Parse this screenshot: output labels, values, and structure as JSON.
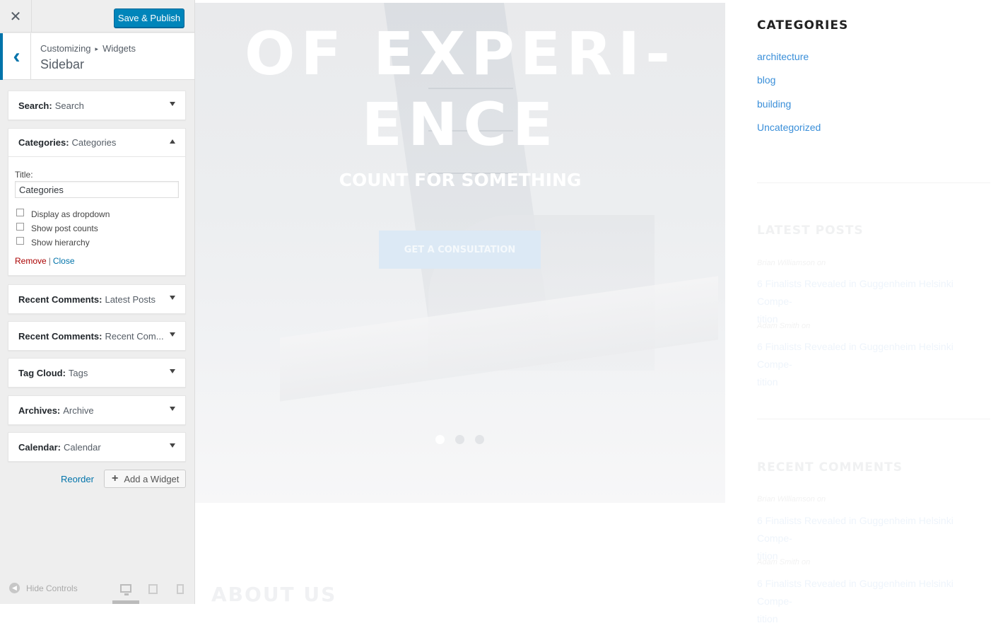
{
  "customizer": {
    "save_label": "Save & Publish",
    "close_glyph": "✕",
    "back_glyph": "‹",
    "breadcrumb": {
      "part1": "Customizing",
      "separator": "▸",
      "part2": "Widgets"
    },
    "panel_title": "Sidebar",
    "widgets": [
      {
        "type": "Search:",
        "name": "Search",
        "expanded": false
      },
      {
        "type": "Categories:",
        "name": "Categories",
        "expanded": true
      },
      {
        "type": "Recent Comments:",
        "name": "Latest Posts",
        "expanded": false
      },
      {
        "type": "Recent Comments:",
        "name": "Recent Com...",
        "expanded": false
      },
      {
        "type": "Tag Cloud:",
        "name": "Tags",
        "expanded": false
      },
      {
        "type": "Archives:",
        "name": "Archive",
        "expanded": false
      },
      {
        "type": "Calendar:",
        "name": "Calendar",
        "expanded": false
      }
    ],
    "categories_form": {
      "title_label": "Title:",
      "title_value": "Categories",
      "checkboxes": [
        {
          "label": "Display as dropdown",
          "checked": false
        },
        {
          "label": "Show post counts",
          "checked": false
        },
        {
          "label": "Show hierarchy",
          "checked": false
        }
      ],
      "remove_label": "Remove",
      "pipe": "|",
      "close_label": "Close"
    },
    "reorder_label": "Reorder",
    "add_widget_label": "Add a Widget",
    "add_widget_glyph": "+",
    "hide_controls_label": "Hide Controls",
    "hide_controls_glyph": "◀"
  },
  "preview": {
    "hero": {
      "title_line1": "OF EXPERI-",
      "title_line2": "ENCE",
      "subtitle": "COUNT FOR SOMETHING",
      "cta_label": "GET A CONSULTATION",
      "slide_count": 3,
      "active_slide": 0
    },
    "about_heading": "ABOUT US",
    "sidebar": {
      "categories_heading": "CATEGORIES",
      "categories": [
        "architecture",
        "blog",
        "building",
        "Uncategorized"
      ],
      "latest_posts_heading": "LATEST POSTS",
      "latest_posts": [
        {
          "meta": "Brian Williamson   on",
          "title_line1": "6 Finalists Revealed in Guggenheim Helsinki Compe-",
          "title_line2": "tition"
        },
        {
          "meta": "Adam Smith   on",
          "title_line1": "6 Finalists Revealed in Guggenheim Helsinki Compe-",
          "title_line2": "tition"
        }
      ],
      "recent_comments_heading": "RECENT COMMENTS",
      "recent_comments": [
        {
          "meta": "Brian Williamson   on",
          "title_line1": "6 Finalists Revealed in Guggenheim Helsinki Compe-",
          "title_line2": "tition"
        },
        {
          "meta": "Adam Smith   on",
          "title_line1": "6 Finalists Revealed in Guggenheim Helsinki Compe-",
          "title_line2": "tition"
        }
      ]
    }
  },
  "colors": {
    "primary_button": "#0085ba",
    "accent_link": "#0073aa",
    "remove_link": "#aa0000",
    "category_link": "#3a8fd9"
  }
}
